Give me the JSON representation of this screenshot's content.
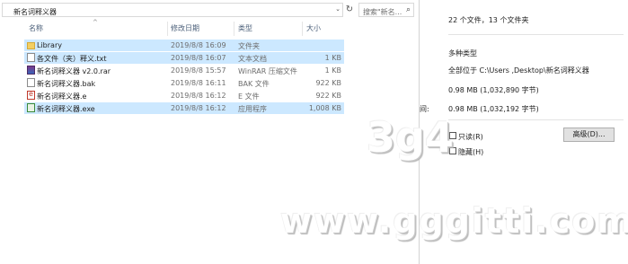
{
  "address_bar": {
    "path": "新名词释义器"
  },
  "search": {
    "placeholder": "搜索\"新名..."
  },
  "columns": {
    "name": "名称",
    "date": "修改日期",
    "type": "类型",
    "size": "大小"
  },
  "files": [
    {
      "name": "Library",
      "date": "2019/8/8 16:09",
      "type": "文件夹",
      "size": "",
      "icon": "folder-icon",
      "selected": true
    },
    {
      "name": "各文件（夹）释义.txt",
      "date": "2019/8/8 16:07",
      "type": "文本文档",
      "size": "1 KB",
      "icon": "text-file-icon",
      "selected": true
    },
    {
      "name": "新名词释义器 v2.0.rar",
      "date": "2019/8/8 15:57",
      "type": "WinRAR 压缩文件",
      "size": "1 KB",
      "icon": "rar-archive-icon",
      "selected": false
    },
    {
      "name": "新名词释义器.bak",
      "date": "2019/8/8 16:11",
      "type": "BAK 文件",
      "size": "922 KB",
      "icon": "bak-file-icon",
      "selected": false
    },
    {
      "name": "新名词释义器.e",
      "date": "2019/8/8 16:12",
      "type": "E 文件",
      "size": "922 KB",
      "icon": "e-file-icon",
      "selected": false
    },
    {
      "name": "新名词释义器.exe",
      "date": "2019/8/8 16:12",
      "type": "应用程序",
      "size": "1,008 KB",
      "icon": "exe-app-icon",
      "selected": true
    }
  ],
  "properties": {
    "summary": "22 个文件，13 个文件夹",
    "type_value": "多种类型",
    "location": "全部位于 C:\\Users           ,Desktop\\新名词释义器",
    "size_value": "0.98 MB (1,032,890 字节)",
    "disk_label": "间:",
    "disk_value": "0.98 MB (1,032,192 字节)",
    "readonly_label": "只读(R)",
    "hidden_label": "隐藏(H)",
    "advanced_button": "高级(D)..."
  },
  "watermark": {
    "top": "3g4",
    "bottom": "www.gggitti.com"
  }
}
